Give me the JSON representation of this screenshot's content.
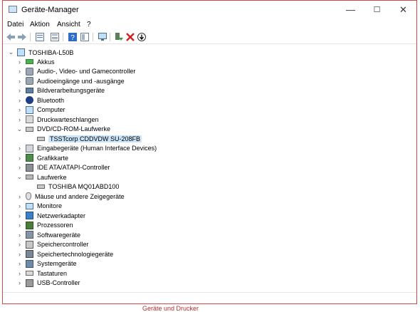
{
  "window": {
    "title": "Geräte-Manager",
    "controls": {
      "minimize": "—",
      "maximize": "☐",
      "close": "✕"
    }
  },
  "menu": [
    "Datei",
    "Aktion",
    "Ansicht",
    "?"
  ],
  "toolbar": [
    "back-icon",
    "forward-icon",
    "properties-icon",
    "list-icon",
    "help-icon",
    "view-icon",
    "monitor-scan-icon",
    "enable-icon",
    "delete-icon",
    "update-icon"
  ],
  "tree": {
    "root": "TOSHIBA-L50B",
    "categories": [
      {
        "label": "Akkus",
        "icon": "battery-icon",
        "expanded": false
      },
      {
        "label": "Audio-, Video- und Gamecontroller",
        "icon": "speaker-icon",
        "expanded": false
      },
      {
        "label": "Audioeingänge und -ausgänge",
        "icon": "speaker-icon",
        "expanded": false
      },
      {
        "label": "Bildverarbeitungsgeräte",
        "icon": "camera-icon",
        "expanded": false
      },
      {
        "label": "Bluetooth",
        "icon": "bluetooth-icon",
        "expanded": false
      },
      {
        "label": "Computer",
        "icon": "computer-icon",
        "expanded": false
      },
      {
        "label": "Druckwarteschlangen",
        "icon": "printer-icon",
        "expanded": false
      },
      {
        "label": "DVD/CD-ROM-Laufwerke",
        "icon": "dvd-drive-icon",
        "expanded": true,
        "children": [
          {
            "label": "TSSTcorp CDDVDW SU-208FB",
            "selected": true
          }
        ]
      },
      {
        "label": "Eingabegeräte (Human Interface Devices)",
        "icon": "hid-icon",
        "expanded": false
      },
      {
        "label": "Grafikkarte",
        "icon": "graphics-card-icon",
        "expanded": false
      },
      {
        "label": "IDE ATA/ATAPI-Controller",
        "icon": "ide-controller-icon",
        "expanded": false
      },
      {
        "label": "Laufwerke",
        "icon": "disk-drive-icon",
        "expanded": true,
        "children": [
          {
            "label": "TOSHIBA MQ01ABD100",
            "selected": false
          }
        ]
      },
      {
        "label": "Mäuse und andere Zeigegeräte",
        "icon": "mouse-icon",
        "expanded": false
      },
      {
        "label": "Monitore",
        "icon": "monitor-icon",
        "expanded": false
      },
      {
        "label": "Netzwerkadapter",
        "icon": "network-adapter-icon",
        "expanded": false
      },
      {
        "label": "Prozessoren",
        "icon": "processor-icon",
        "expanded": false
      },
      {
        "label": "Softwaregeräte",
        "icon": "software-device-icon",
        "expanded": false
      },
      {
        "label": "Speichercontroller",
        "icon": "storage-controller-icon",
        "expanded": false
      },
      {
        "label": "Speichertechnologiegeräte",
        "icon": "storage-tech-icon",
        "expanded": false
      },
      {
        "label": "Systemgeräte",
        "icon": "system-device-icon",
        "expanded": false
      },
      {
        "label": "Tastaturen",
        "icon": "keyboard-icon",
        "expanded": false
      },
      {
        "label": "USB-Controller",
        "icon": "usb-icon",
        "expanded": false
      }
    ]
  },
  "background_text": "Geräte und Drucker",
  "colors": {
    "selection": "#cce4f7",
    "border": "#d04a4a"
  }
}
